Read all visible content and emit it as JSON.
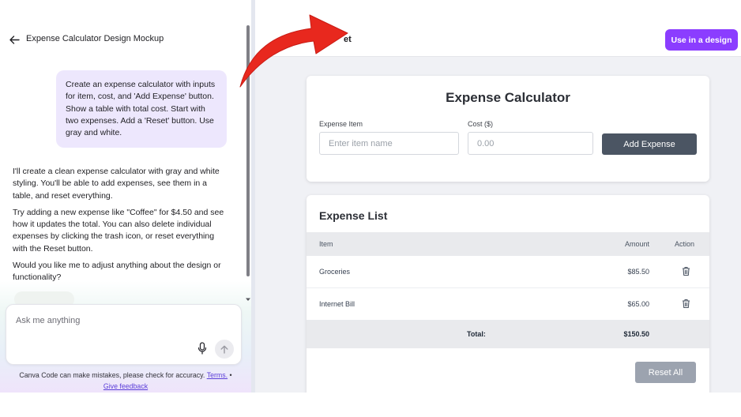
{
  "chat": {
    "title": "Expense Calculator Design Mockup",
    "user_message": "Create an expense calculator with inputs for item, cost, and 'Add Expense' button. Show a table with total cost. Start with two expenses. Add a 'Reset' button. Use gray and white.",
    "assistant_paragraphs": [
      "I'll create a clean expense calculator with gray and white styling. You'll be able to add expenses, see them in a table, and reset everything.",
      "Try adding a new expense like \"Coffee\" for $4.50 and see how it updates the total. You can also delete individual expenses by clicking the trash icon, or reset everything with the Reset button.",
      "Would you like me to adjust anything about the design or functionality?"
    ],
    "input_placeholder": "Ask me anything",
    "disclaimer_text": "Canva Code can make mistakes, please check for accuracy.",
    "terms_link": "Terms.",
    "bullet": "•",
    "feedback_link": "Give feedback"
  },
  "preview": {
    "title": "et",
    "use_button": "Use in a design",
    "calculator": {
      "title": "Expense Calculator",
      "item_label": "Expense Item",
      "item_placeholder": "Enter item name",
      "cost_label": "Cost ($)",
      "cost_placeholder": "0.00",
      "add_button": "Add Expense"
    },
    "list": {
      "title": "Expense List",
      "columns": [
        "Item",
        "Amount",
        "Action"
      ],
      "rows": [
        {
          "item": "Groceries",
          "amount": "$85.50"
        },
        {
          "item": "Internet Bill",
          "amount": "$65.00"
        }
      ],
      "total_label": "Total:",
      "total_value": "$150.50",
      "reset_button": "Reset All"
    }
  },
  "colors": {
    "accent_purple": "#8b3dff",
    "user_bubble": "#ede7fd",
    "add_button": "#4b5563",
    "reset_button": "#9ca3af",
    "annotation_arrow": "#e8281e"
  },
  "icons": [
    "arrow-left-icon",
    "microphone-icon",
    "arrow-up-icon",
    "trash-icon",
    "chevron-down-icon",
    "red-curved-arrow"
  ]
}
